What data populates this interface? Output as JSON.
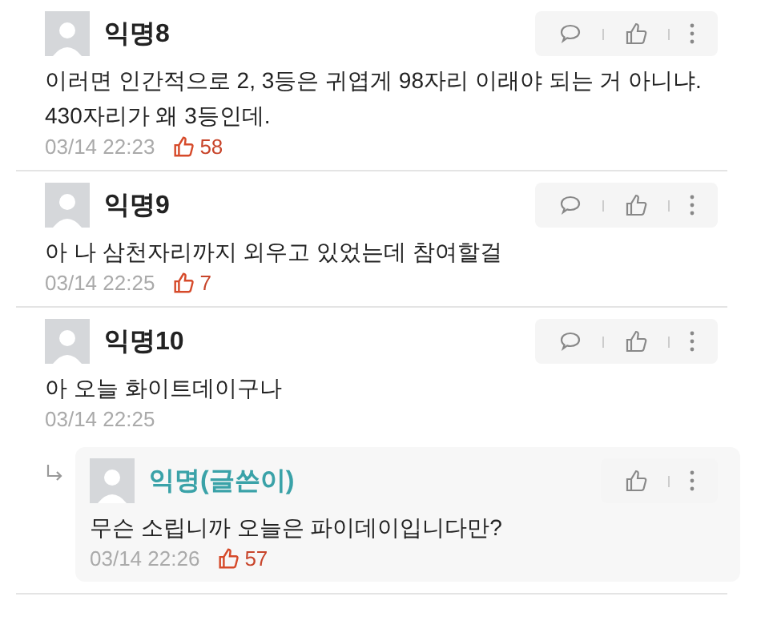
{
  "comments": [
    {
      "author": "익명8",
      "is_writer": false,
      "body": "이러면 인간적으로 2, 3등은 귀엽게 98자리 이래야 되는 거 아니냐. 430자리가 왜 3등인데.",
      "time": "03/14 22:23",
      "likes": "58"
    },
    {
      "author": "익명9",
      "is_writer": false,
      "body": "아 나 삼천자리까지 외우고 있었는데 참여할걸",
      "time": "03/14 22:25",
      "likes": "7"
    },
    {
      "author": "익명10",
      "is_writer": false,
      "body": "아 오늘 화이트데이구나",
      "time": "03/14 22:25",
      "replies": [
        {
          "author": "익명(글쓴이)",
          "is_writer": true,
          "body": "무슨 소립니까 오늘은 파이데이입니다만?",
          "time": "03/14 22:26",
          "likes": "57"
        }
      ]
    }
  ]
}
